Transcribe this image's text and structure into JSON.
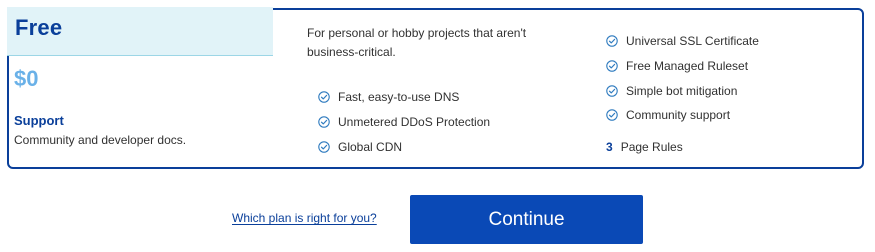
{
  "plan": {
    "name": "Free",
    "price": "$0",
    "support_title": "Support",
    "support_desc": "Community and developer docs.",
    "description": "For personal or hobby projects that aren't business-critical."
  },
  "features_col1": [
    {
      "label": "Fast, easy-to-use DNS",
      "icon": "check-circle-icon"
    },
    {
      "label": "Unmetered DDoS Protection",
      "icon": "check-circle-icon"
    },
    {
      "label": "Global CDN",
      "icon": "check-circle-icon"
    }
  ],
  "features_col2": [
    {
      "label": "Universal SSL Certificate",
      "icon": "check-circle-icon"
    },
    {
      "label": "Free Managed Ruleset",
      "icon": "check-circle-icon"
    },
    {
      "label": "Simple bot mitigation",
      "icon": "check-circle-icon"
    },
    {
      "label": "Community support",
      "icon": "check-circle-icon"
    }
  ],
  "page_rules": {
    "count": "3",
    "label": "Page Rules"
  },
  "footer": {
    "help_link": "Which plan is right for you?",
    "continue_label": "Continue"
  },
  "colors": {
    "accent": "#0a3f9a",
    "button": "#0a49b6",
    "header_bg": "#e1f3f8",
    "price": "#6ab1e8",
    "check": "#2f7bbf"
  }
}
